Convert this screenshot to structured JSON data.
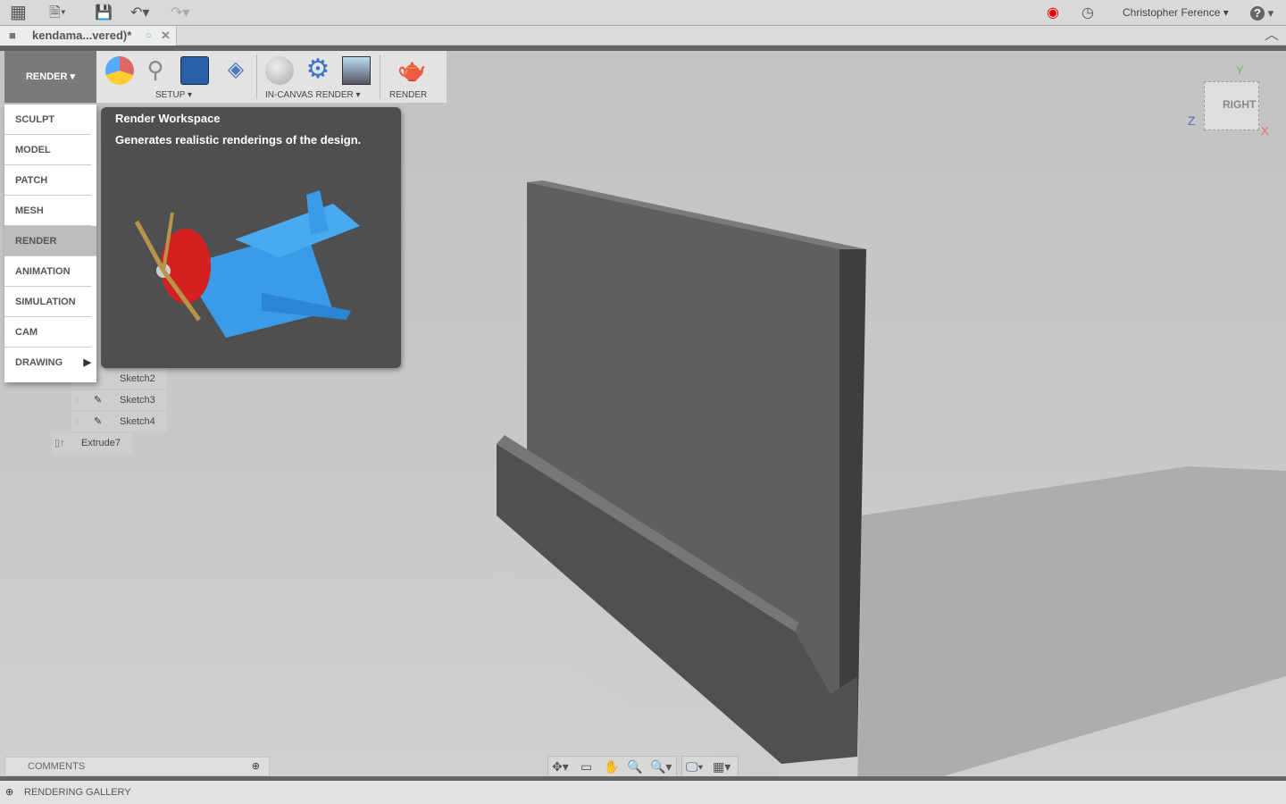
{
  "topbar": {
    "user": "Christopher Ference",
    "help": "?"
  },
  "document": {
    "tab_title": "kendama...vered)*"
  },
  "toolbar": {
    "workspace": "RENDER",
    "groups": [
      "SETUP",
      "IN-CANVAS RENDER",
      "RENDER"
    ]
  },
  "workspace_menu": {
    "items": [
      "SCULPT",
      "MODEL",
      "PATCH",
      "MESH",
      "RENDER",
      "ANIMATION",
      "SIMULATION",
      "CAM",
      "DRAWING"
    ],
    "active": "RENDER"
  },
  "tooltip": {
    "title": "Render Workspace",
    "description": "Generates realistic renderings of the design."
  },
  "browser": {
    "items": [
      "Sketch2",
      "Sketch3",
      "Sketch4",
      "Extrude7"
    ]
  },
  "viewcube": {
    "face": "RIGHT",
    "axes": [
      "X",
      "Y",
      "Z"
    ]
  },
  "comments": {
    "label": "COMMENTS"
  },
  "status": {
    "label": "RENDERING GALLERY"
  }
}
